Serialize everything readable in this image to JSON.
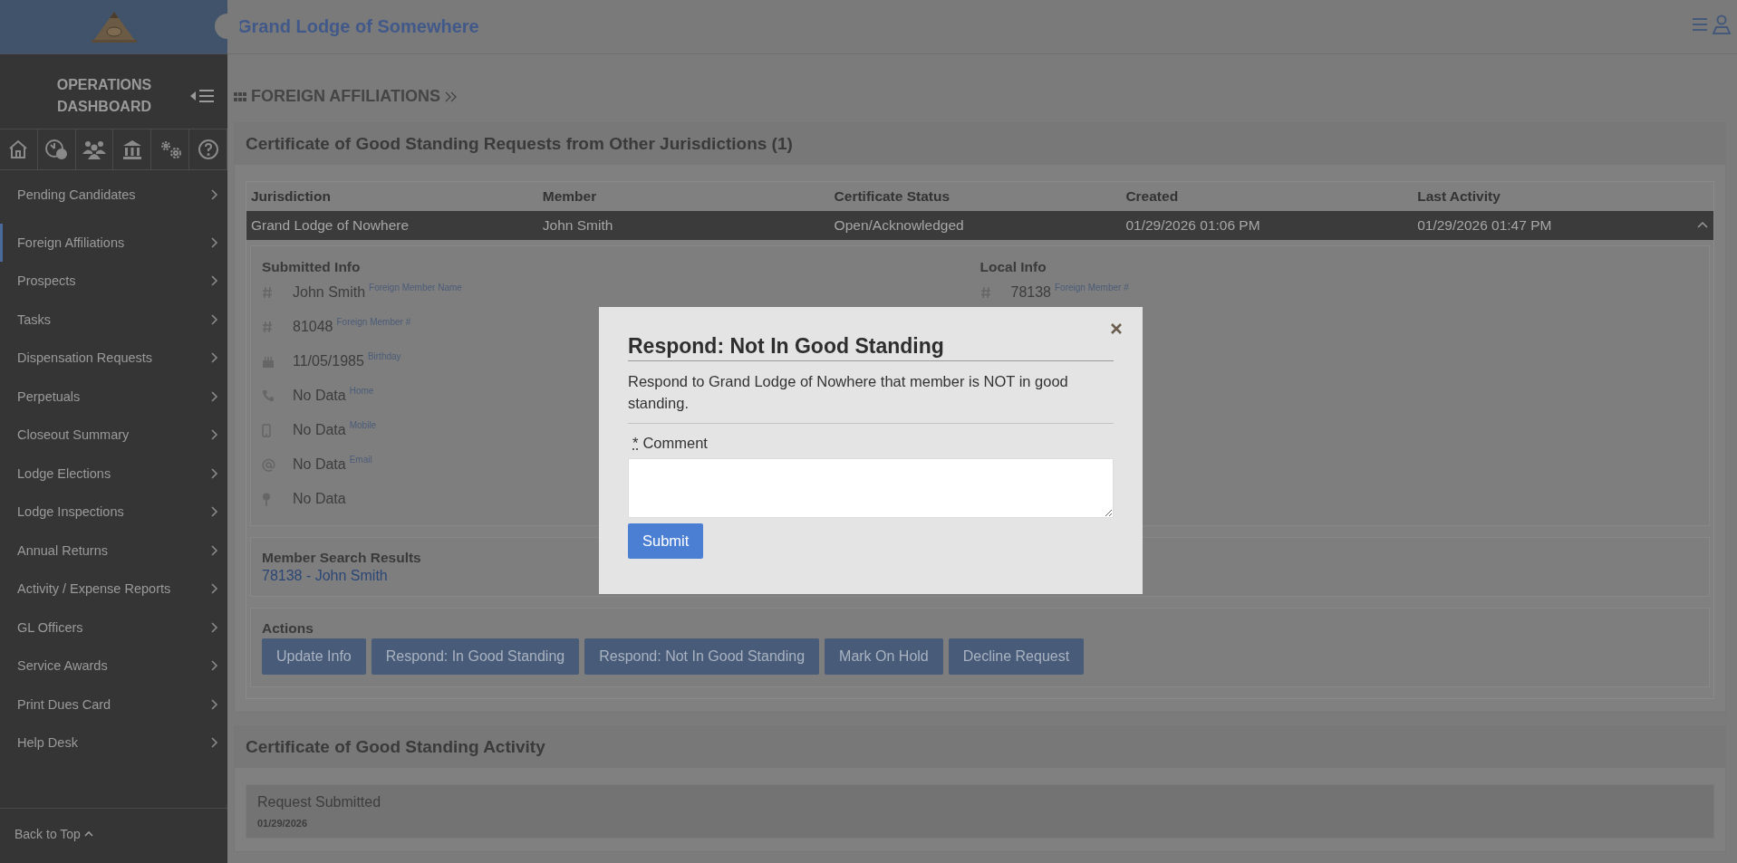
{
  "header": {
    "title": "Grand Lodge of Somewhere"
  },
  "sidebar": {
    "title": "OPERATIONS DASHBOARD",
    "items": [
      {
        "label": "Pending Candidates",
        "selected": false
      },
      {
        "label": "Foreign Affiliations",
        "selected": true
      },
      {
        "label": "Prospects",
        "selected": false
      },
      {
        "label": "Tasks",
        "selected": false
      },
      {
        "label": "Dispensation Requests",
        "selected": false
      },
      {
        "label": "Perpetuals",
        "selected": false
      },
      {
        "label": "Closeout Summary",
        "selected": false
      },
      {
        "label": "Lodge Elections",
        "selected": false
      },
      {
        "label": "Lodge Inspections",
        "selected": false
      },
      {
        "label": "Annual Returns",
        "selected": false
      },
      {
        "label": "Activity / Expense Reports",
        "selected": false
      },
      {
        "label": "GL Officers",
        "selected": false
      },
      {
        "label": "Service Awards",
        "selected": false
      },
      {
        "label": "Print Dues Card",
        "selected": false
      },
      {
        "label": "Help Desk",
        "selected": false
      }
    ],
    "back_to_top": "Back to Top"
  },
  "breadcrumb": "FOREIGN AFFILIATIONS",
  "requests": {
    "title": "Certificate of Good Standing Requests from Other Jurisdictions (1)",
    "columns": [
      "Jurisdiction",
      "Member",
      "Certificate Status",
      "Created",
      "Last Activity"
    ],
    "rows": [
      {
        "cells": [
          "Grand Lodge of Nowhere",
          "John Smith",
          "Open/Acknowledged",
          "01/29/2026 01:06 PM",
          "01/29/2026 01:47 PM"
        ],
        "selected": true,
        "expanded": true
      }
    ]
  },
  "submitted_info": {
    "title": "Submitted Info",
    "fields": [
      {
        "kind": "hash",
        "value": "John Smith",
        "label": "Foreign Member Name"
      },
      {
        "kind": "hash",
        "value": "81048",
        "label": "Foreign Member #"
      },
      {
        "kind": "cake",
        "value": "11/05/1985",
        "label": "Birthday"
      },
      {
        "kind": "phone",
        "value": "No Data",
        "label": "Home"
      },
      {
        "kind": "mobile",
        "value": "No Data",
        "label": "Mobile"
      },
      {
        "kind": "email",
        "value": "No Data",
        "label": "Email"
      },
      {
        "kind": "pin",
        "value": "No Data"
      }
    ]
  },
  "local_info": {
    "title": "Local Info",
    "fields": [
      {
        "kind": "hash",
        "value": "78138",
        "label": "Foreign Member #"
      }
    ]
  },
  "member_search": {
    "title": "Member Search Results",
    "results": [
      "78138 - John Smith"
    ]
  },
  "actions": {
    "title": "Actions",
    "buttons": [
      "Update Info",
      "Respond: In Good Standing",
      "Respond: Not In Good Standing",
      "Mark On Hold",
      "Decline Request"
    ]
  },
  "activity": {
    "title": "Certificate of Good Standing Activity",
    "items": [
      {
        "title": "Request Submitted",
        "date": "01/29/2026"
      }
    ]
  },
  "modal": {
    "title": "Respond: Not In Good Standing",
    "message": "Respond to Grand Lodge of Nowhere that member is NOT in good standing.",
    "required_mark": "*",
    "field_label": "Comment",
    "submit": "Submit"
  }
}
